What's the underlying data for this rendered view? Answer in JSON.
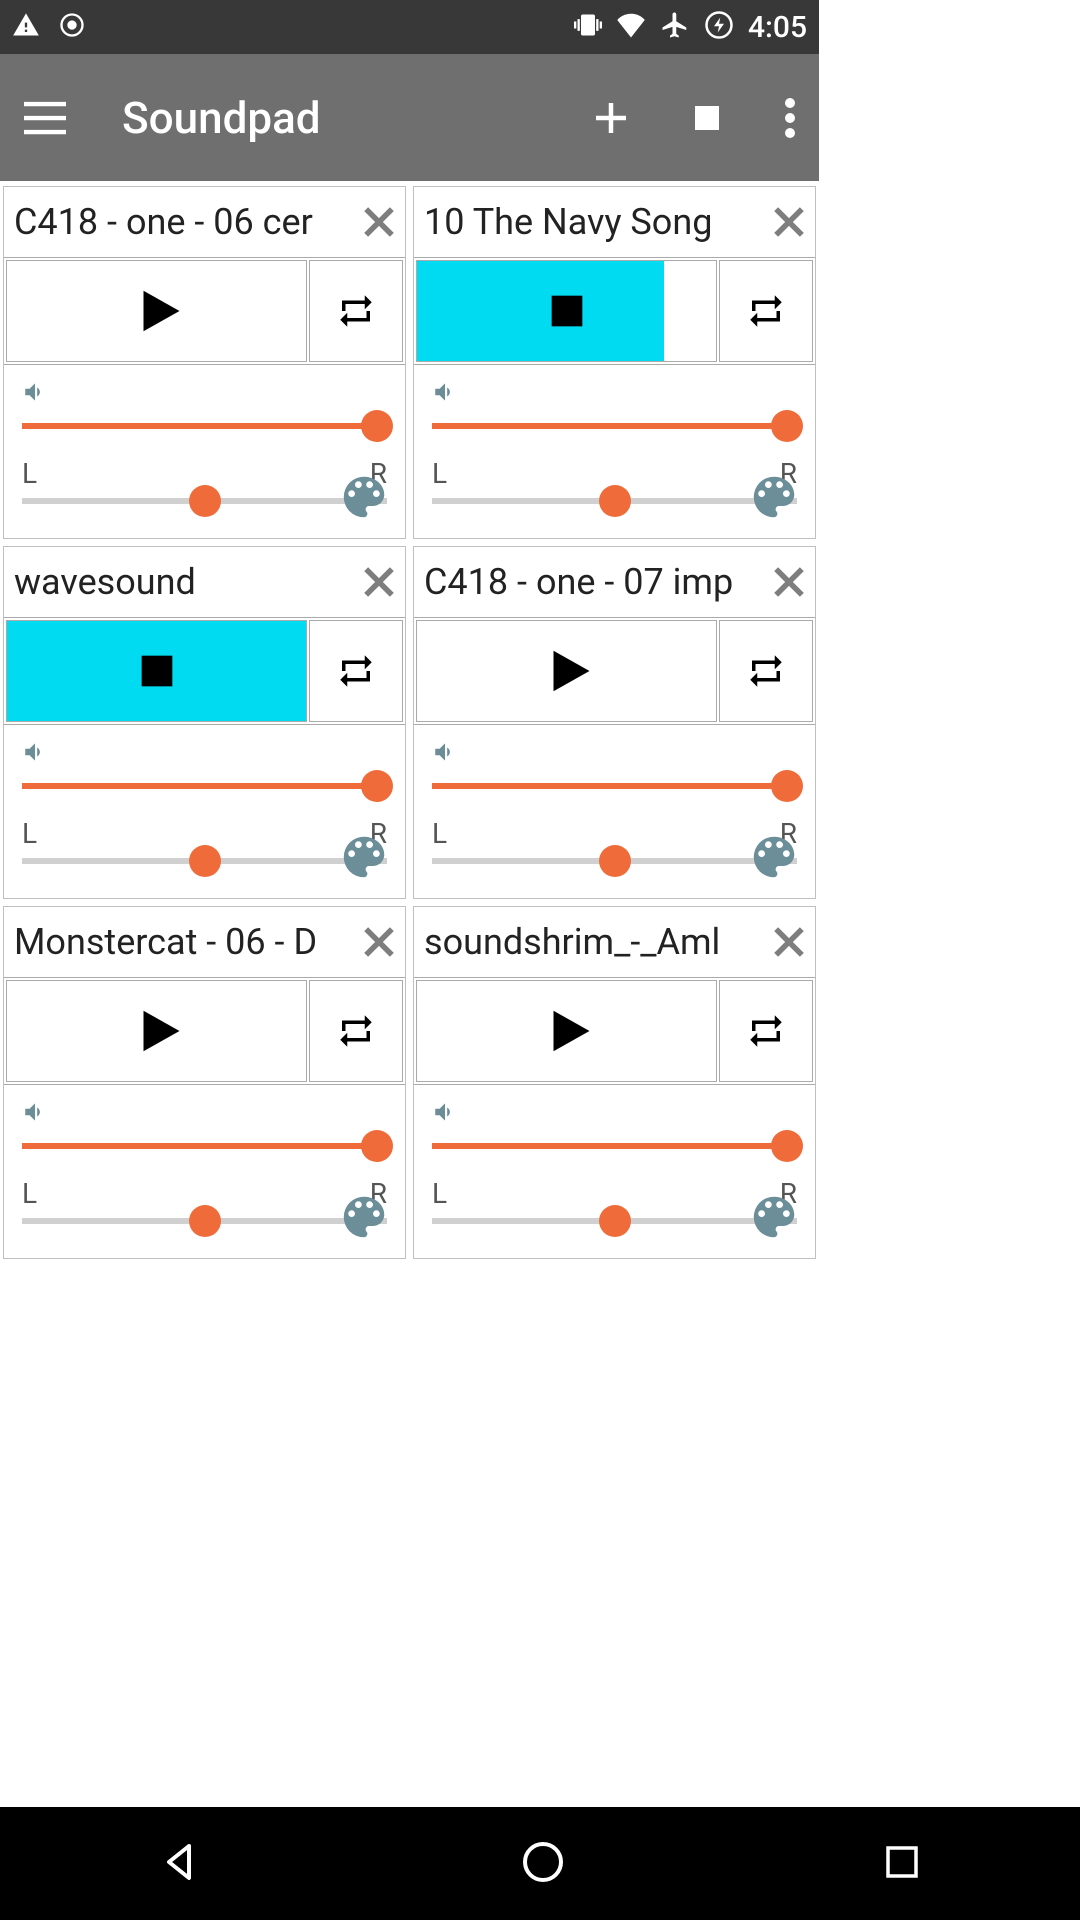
{
  "status": {
    "time": "4:05"
  },
  "appbar": {
    "title": "Soundpad"
  },
  "pan": {
    "left": "L",
    "right": "R"
  },
  "pads": [
    {
      "title": "C418 - one - 06 cer",
      "playing": false,
      "volume": 100,
      "pan": 50
    },
    {
      "title": "10 The Navy Song",
      "playing": true,
      "progress": true,
      "volume": 100,
      "pan": 50
    },
    {
      "title": "wavesound",
      "playing": true,
      "progress": false,
      "volume": 100,
      "pan": 50
    },
    {
      "title": "C418 - one - 07 imp",
      "playing": false,
      "volume": 100,
      "pan": 50
    },
    {
      "title": "Monstercat - 06 - D",
      "playing": false,
      "volume": 100,
      "pan": 50
    },
    {
      "title": "soundshrim_-_Aml",
      "playing": false,
      "volume": 100,
      "pan": 50
    }
  ]
}
